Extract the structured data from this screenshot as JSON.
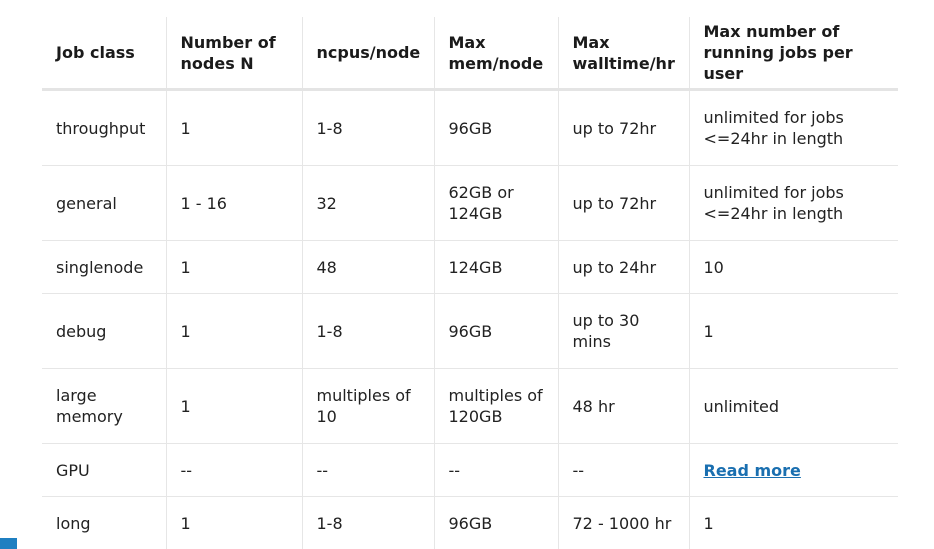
{
  "headers": [
    "Job class",
    "Number of nodes N",
    "ncpus/node",
    "Max mem/node",
    "Max walltime/hr",
    "Max number of running jobs per user"
  ],
  "rows": [
    [
      "throughput",
      "1",
      "1-8",
      "96GB",
      "up to 72hr",
      "unlimited for jobs <=24hr in length"
    ],
    [
      "general",
      "1 - 16",
      "32",
      "62GB or 124GB",
      "up to 72hr",
      "unlimited for jobs <=24hr in length"
    ],
    [
      "singlenode",
      "1",
      "48",
      "124GB",
      "up to 24hr",
      "10"
    ],
    [
      "debug",
      "1",
      "1-8",
      "96GB",
      "up to 30 mins",
      "1"
    ],
    [
      "large memory",
      "1",
      "multiples of 10",
      "multiples of 120GB",
      "48 hr",
      "unlimited"
    ],
    [
      "GPU",
      "--",
      "--",
      "--",
      "--",
      "Read more"
    ],
    [
      "long",
      "1",
      "1-8",
      "96GB",
      "72 - 1000 hr",
      "1"
    ]
  ],
  "colors": {
    "link": "#1a6fb0",
    "corner_accent": "#1f7fc1"
  }
}
